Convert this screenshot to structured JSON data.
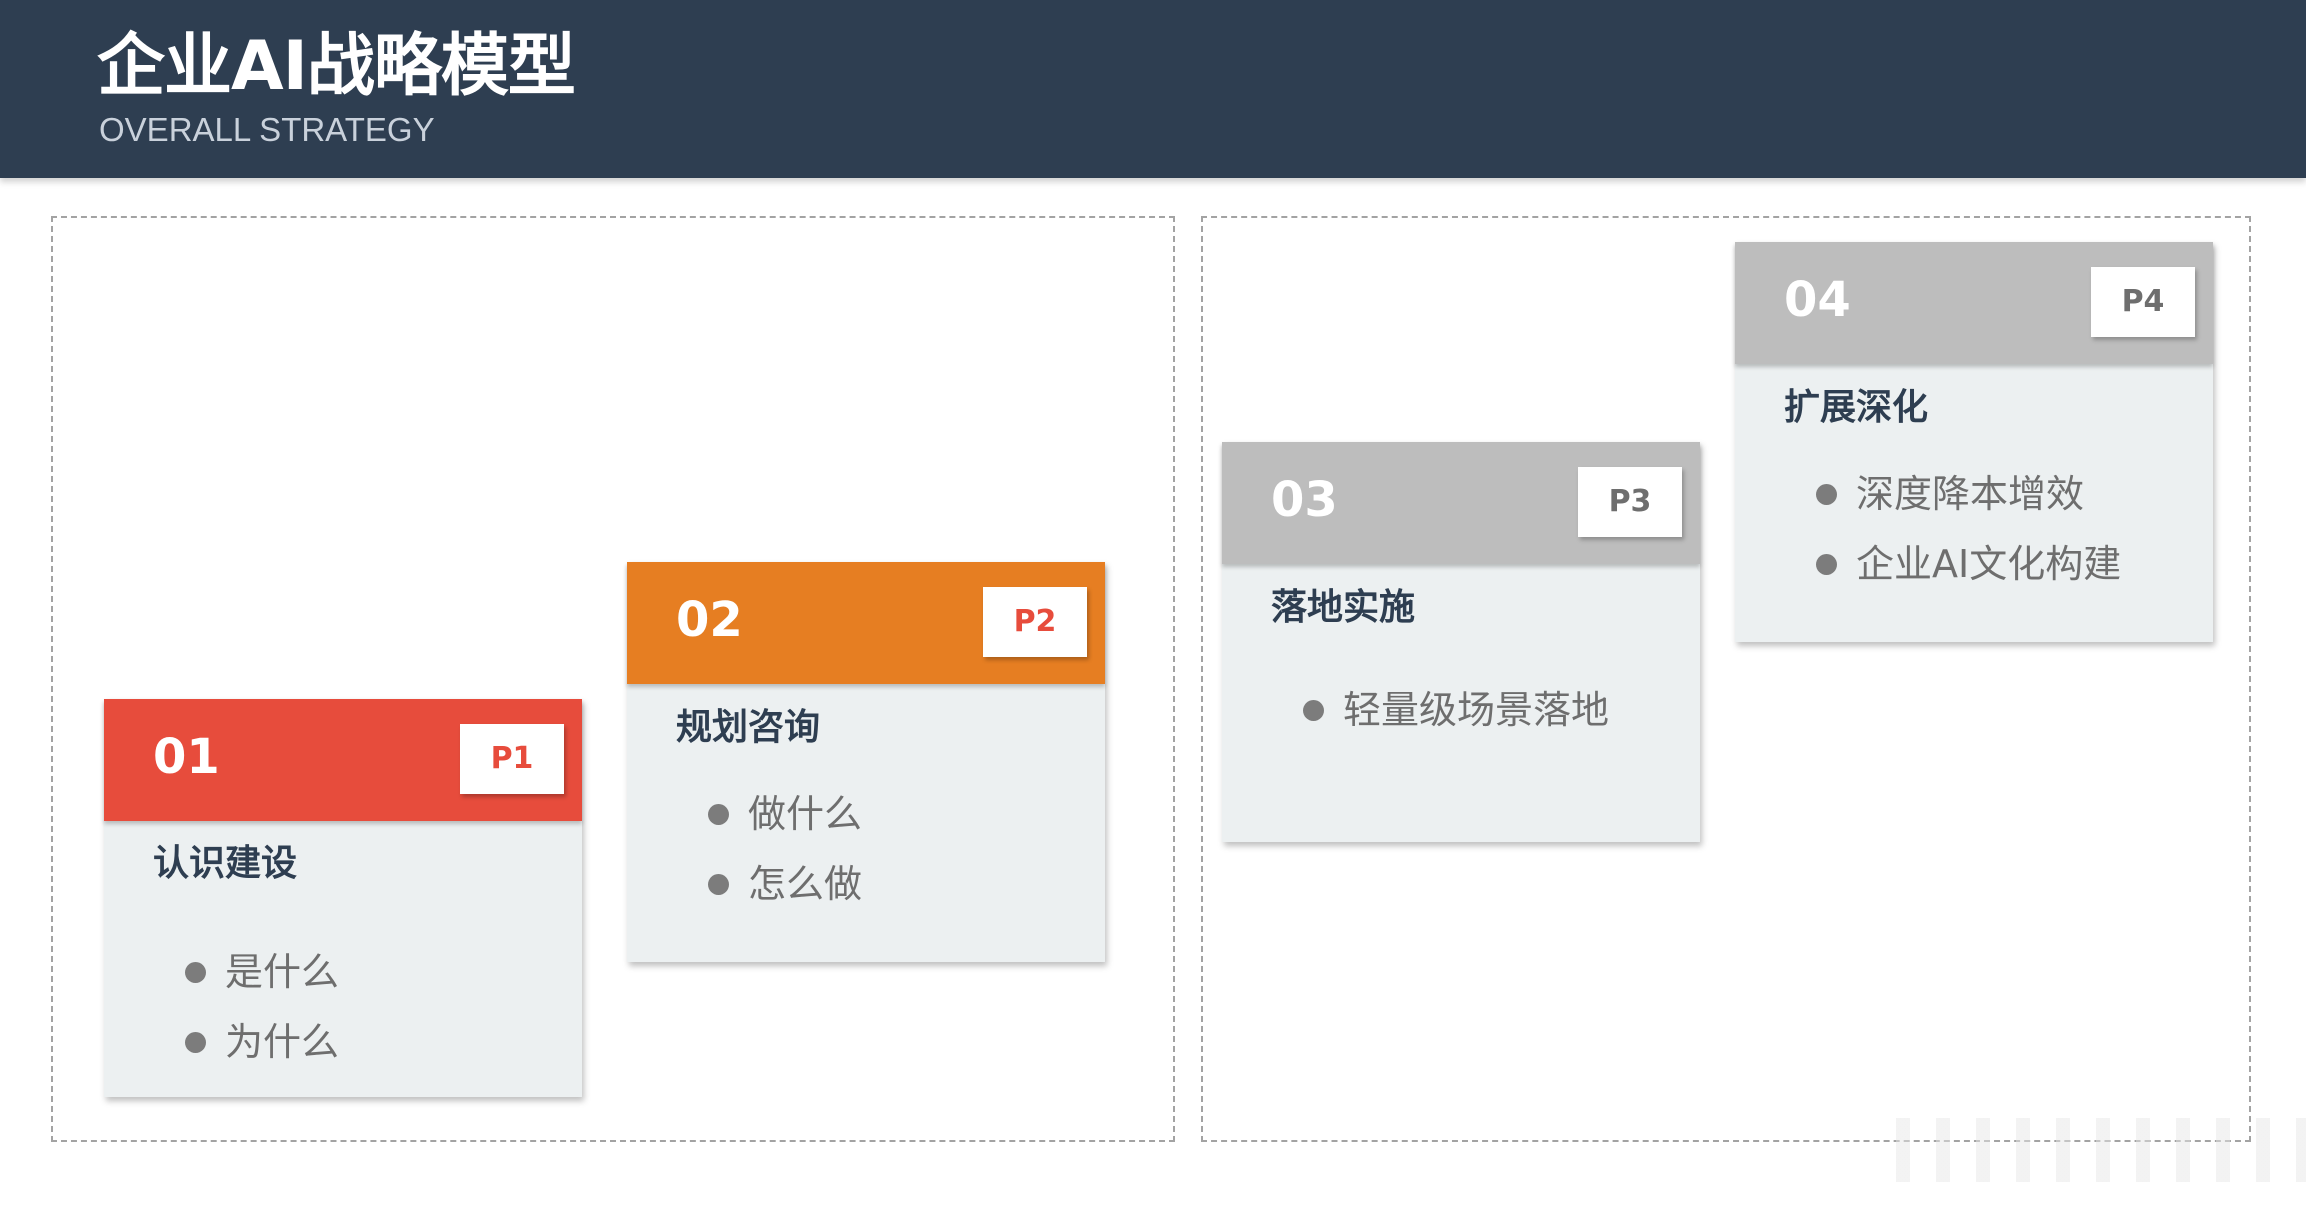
{
  "header": {
    "title": "企业AI战略模型",
    "subtitle": "OVERALL STRATEGY"
  },
  "colors": {
    "header_bg": "#2e3e51",
    "card_bg": "#ecf0f1",
    "phase1": "#e74c3c",
    "phase2": "#e67e22",
    "phase3": "#bdbdbd",
    "phase4": "#bdbdbd"
  },
  "cards": [
    {
      "number": "01",
      "badge": "P1",
      "title": "认识建设",
      "items": [
        "是什么",
        "为什么"
      ]
    },
    {
      "number": "02",
      "badge": "P2",
      "title": "规划咨询",
      "items": [
        "做什么",
        "怎么做"
      ]
    },
    {
      "number": "03",
      "badge": "P3",
      "title": "落地实施",
      "items": [
        "轻量级场景落地"
      ]
    },
    {
      "number": "04",
      "badge": "P4",
      "title": "扩展深化",
      "items": [
        "深度降本增效",
        "企业AI文化构建"
      ]
    }
  ]
}
